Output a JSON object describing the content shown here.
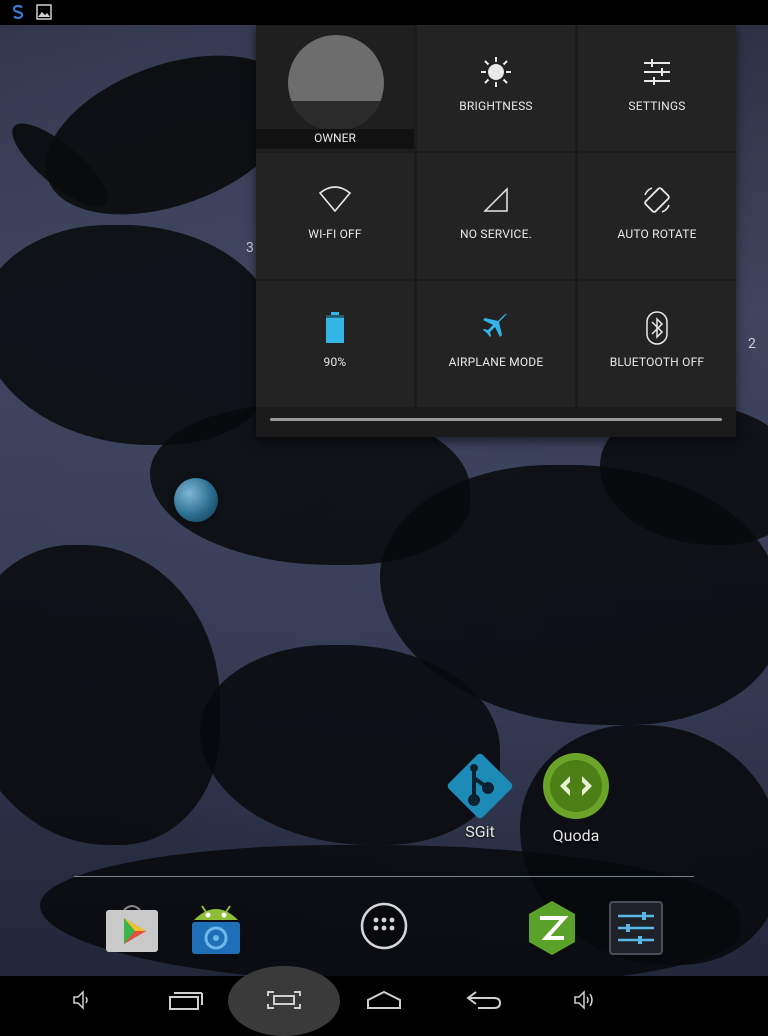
{
  "status_bar": {
    "icons": [
      "s-app-icon",
      "image-notification-icon"
    ]
  },
  "quick_settings": {
    "owner_label": "OWNER",
    "tiles": [
      {
        "id": "brightness",
        "label": "BRIGHTNESS",
        "icon": "brightness-icon"
      },
      {
        "id": "settings",
        "label": "SETTINGS",
        "icon": "settings-sliders-icon"
      },
      {
        "id": "wifi",
        "label": "WI-FI OFF",
        "icon": "wifi-icon"
      },
      {
        "id": "signal",
        "label": "NO SERVICE.",
        "icon": "signal-icon"
      },
      {
        "id": "rotate",
        "label": "AUTO ROTATE",
        "icon": "rotate-icon"
      },
      {
        "id": "battery",
        "label": "90%",
        "icon": "battery-icon",
        "level_percent": 90
      },
      {
        "id": "airplane",
        "label": "AIRPLANE MODE",
        "icon": "airplane-icon",
        "active_color": "#33b5e5"
      },
      {
        "id": "bluetooth",
        "label": "BLUETOOTH OFF",
        "icon": "bluetooth-icon"
      }
    ]
  },
  "desktop": {
    "edge_left_num": "3",
    "edge_right_num": "2",
    "apps": [
      {
        "label": "SGit",
        "icon": "sgit-icon",
        "color": "#1e8ab8"
      },
      {
        "label": "Quoda",
        "icon": "quoda-icon",
        "color": "#6aa52a"
      }
    ]
  },
  "dock": {
    "items": [
      "play-store-icon",
      "android-app-icon",
      "app-drawer-icon",
      "zarchiver-icon",
      "settings-app-icon"
    ]
  },
  "nav_bar": {
    "buttons": [
      "volume-down-icon",
      "recent-apps-icon",
      "screenshot-icon",
      "home-icon",
      "back-icon",
      "volume-up-icon"
    ]
  }
}
